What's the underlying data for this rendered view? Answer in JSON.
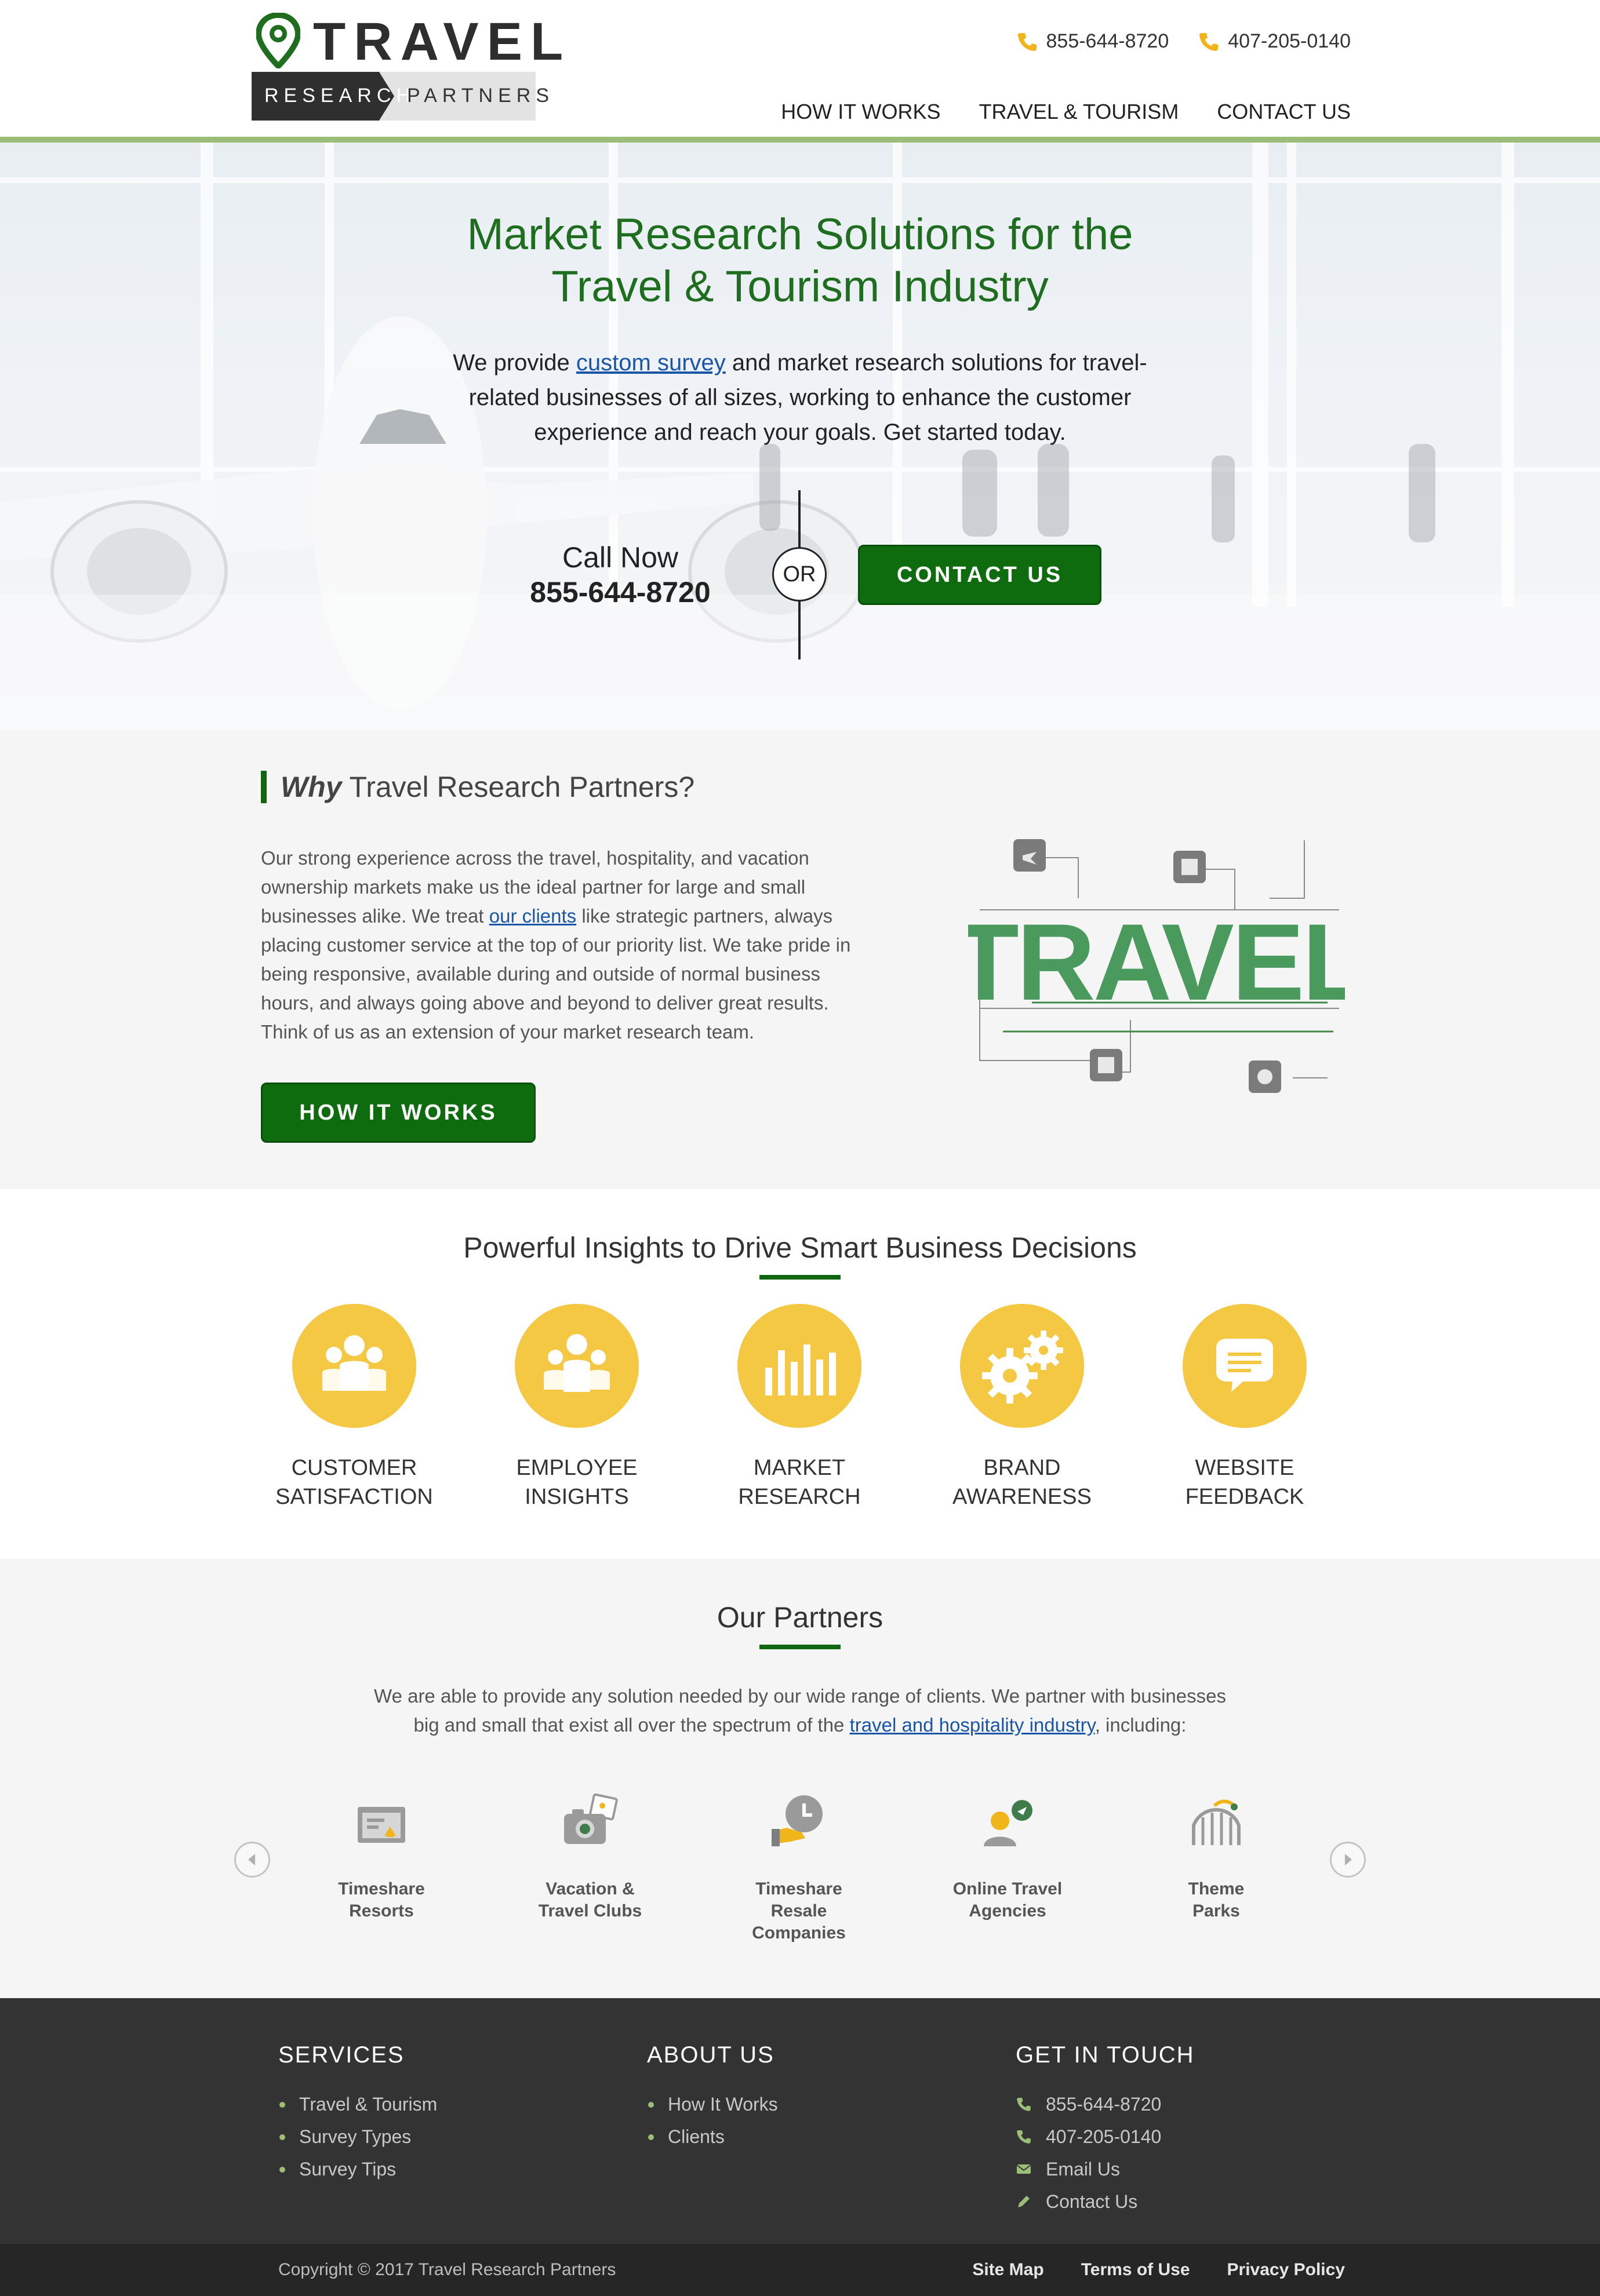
{
  "brand": {
    "logo_word": "TRAVEL",
    "logo_left": "RESEARCH",
    "logo_right": "PARTNERS",
    "green": "#116611",
    "yellow": "#f4c842"
  },
  "header": {
    "phones": [
      "855-644-8720",
      "407-205-0140"
    ],
    "nav": [
      "HOW IT WORKS",
      "TRAVEL & TOURISM",
      "CONTACT US"
    ]
  },
  "hero": {
    "title_line1": "Market Research Solutions for the",
    "title_line2": "Travel & Tourism Industry",
    "text_before": "We provide ",
    "text_link": "custom survey",
    "text_after": " and market research solutions for travel-related businesses of all sizes, working to enhance the customer experience and reach your goals. Get started today.",
    "call_label": "Call Now",
    "call_number": "855-644-8720",
    "or": "OR",
    "button": "CONTACT US"
  },
  "why": {
    "heading_em": "Why",
    "heading_rest": " Travel Research Partners?",
    "text_before": "Our strong experience across the travel, hospitality, and vacation ownership markets make us the ideal partner for large and small businesses alike. We treat ",
    "text_link": "our clients",
    "text_after": " like strategic partners, always placing customer service at the top of our priority list. We take pride in being responsive, available during and outside of normal business hours, and always going above and beyond to deliver great results. Think of us as an extension of your market research team.",
    "button": "HOW IT WORKS",
    "graphic_word": "TRAVEL"
  },
  "insights": {
    "title": "Powerful Insights to Drive Smart Business Decisions",
    "items": [
      {
        "line1": "CUSTOMER",
        "line2": "SATISFACTION",
        "icon": "group-icon"
      },
      {
        "line1": "EMPLOYEE",
        "line2": "INSIGHTS",
        "icon": "team-icon"
      },
      {
        "line1": "MARKET",
        "line2": "RESEARCH",
        "icon": "bar-chart-icon"
      },
      {
        "line1": "BRAND",
        "line2": "AWARENESS",
        "icon": "gears-icon"
      },
      {
        "line1": "WEBSITE",
        "line2": "FEEDBACK",
        "icon": "chat-bubble-icon"
      }
    ]
  },
  "partners": {
    "title": "Our Partners",
    "text_before": "We are able to provide any solution needed by our wide range of clients. We partner with businesses big and small that exist all over the spectrum of the ",
    "text_link": "travel and hospitality industry",
    "text_after": ", including:",
    "items": [
      {
        "line1": "Timeshare",
        "line2": "Resorts",
        "line3": "",
        "icon": "resort-icon"
      },
      {
        "line1": "Vacation &",
        "line2": "Travel Clubs",
        "line3": "",
        "icon": "camera-photo-icon"
      },
      {
        "line1": "Timeshare",
        "line2": "Resale",
        "line3": "Companies",
        "icon": "clock-hand-icon"
      },
      {
        "line1": "Online Travel",
        "line2": "Agencies",
        "line3": "",
        "icon": "agent-icon"
      },
      {
        "line1": "Theme",
        "line2": "Parks",
        "line3": "",
        "icon": "rollercoaster-icon"
      }
    ]
  },
  "footer": {
    "services_title": "SERVICES",
    "services": [
      "Travel & Tourism",
      "Survey Types",
      "Survey Tips"
    ],
    "about_title": "ABOUT US",
    "about": [
      "How It Works",
      "Clients"
    ],
    "contact_title": "GET IN TOUCH",
    "contact": [
      "855-644-8720",
      "407-205-0140",
      "Email Us",
      "Contact Us"
    ],
    "copyright": "Copyright © 2017 Travel Research Partners",
    "links": [
      "Site Map",
      "Terms of Use",
      "Privacy Policy"
    ]
  }
}
